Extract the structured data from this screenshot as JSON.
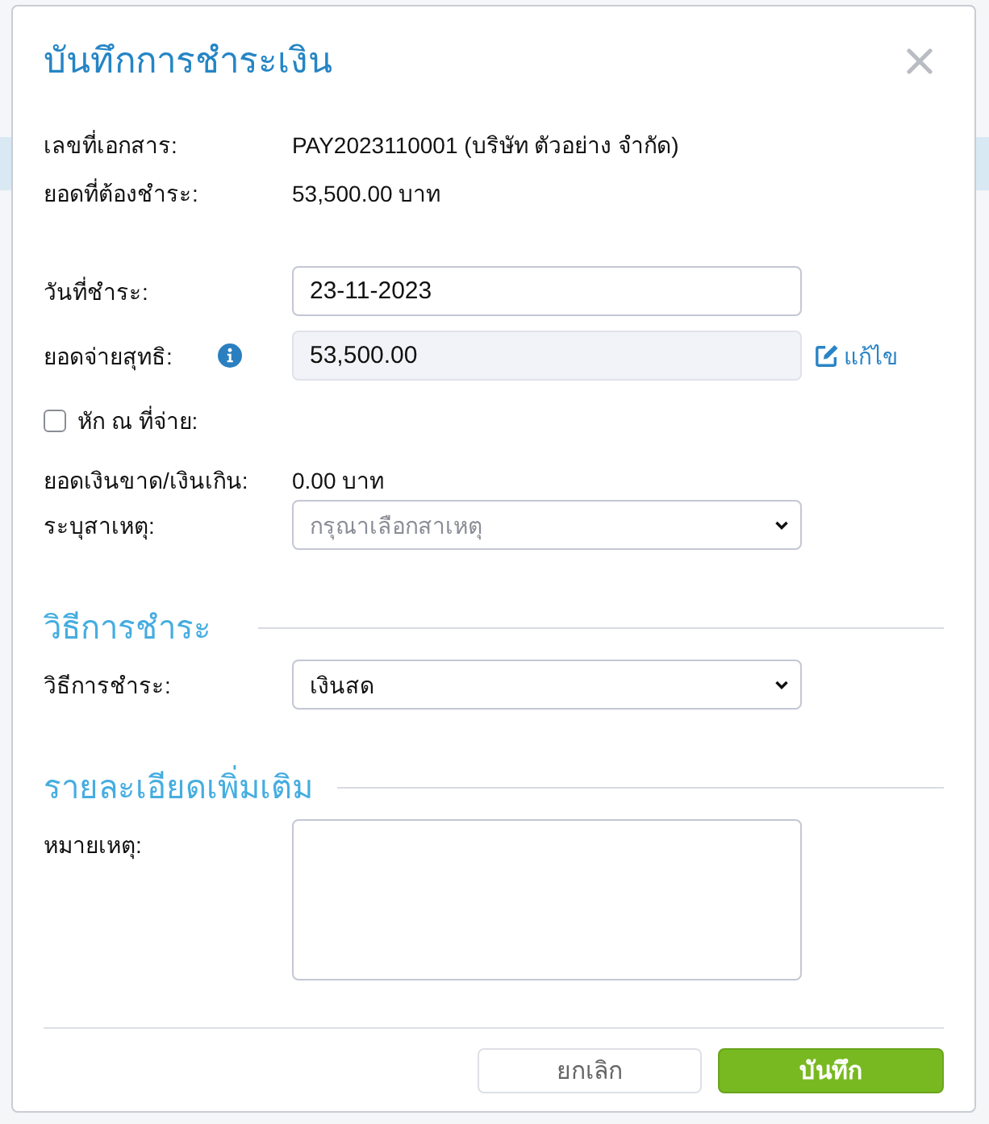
{
  "dialog": {
    "title": "บันทึกการชำระเงิน"
  },
  "summary": [
    {
      "label": "เลขที่เอกสาร:",
      "value": "PAY2023110001 (บริษัท ตัวอย่าง จำกัด)"
    },
    {
      "label": "ยอดที่ต้องชำระ:",
      "value": "53,500.00 บาท"
    }
  ],
  "sections": [
    {
      "fields": [
        {
          "kind": "input",
          "label": "วันที่ชำระ:",
          "value": "23-11-2023",
          "disabled": false
        },
        {
          "kind": "input",
          "label": "ยอดจ่ายสุทธิ:",
          "value": "53,500.00",
          "disabled": true,
          "info": true,
          "action": "แก้ไข"
        },
        {
          "kind": "checkbox",
          "label": "หัก ณ ที่จ่าย:",
          "checked": false
        },
        {
          "kind": "text",
          "label": "ยอดเงินขาด/เงินเกิน:",
          "value": "0.00 บาท"
        },
        {
          "kind": "select",
          "label": "ระบุสาเหตุ:",
          "placeholder": "กรุณาเลือกสาเหตุ"
        }
      ]
    },
    {
      "title": "วิธีการชำระ",
      "fields": [
        {
          "kind": "select",
          "label": "วิธีการชำระ:",
          "value": "เงินสด"
        }
      ]
    },
    {
      "title": "รายละเอียดเพิ่มเติม",
      "fields": [
        {
          "kind": "textarea",
          "label": "หมายเหตุ:"
        }
      ]
    }
  ],
  "buttons": [
    {
      "label": "ยกเลิก",
      "kind": "secondary"
    },
    {
      "label": "บันทึก",
      "kind": "primary"
    }
  ]
}
